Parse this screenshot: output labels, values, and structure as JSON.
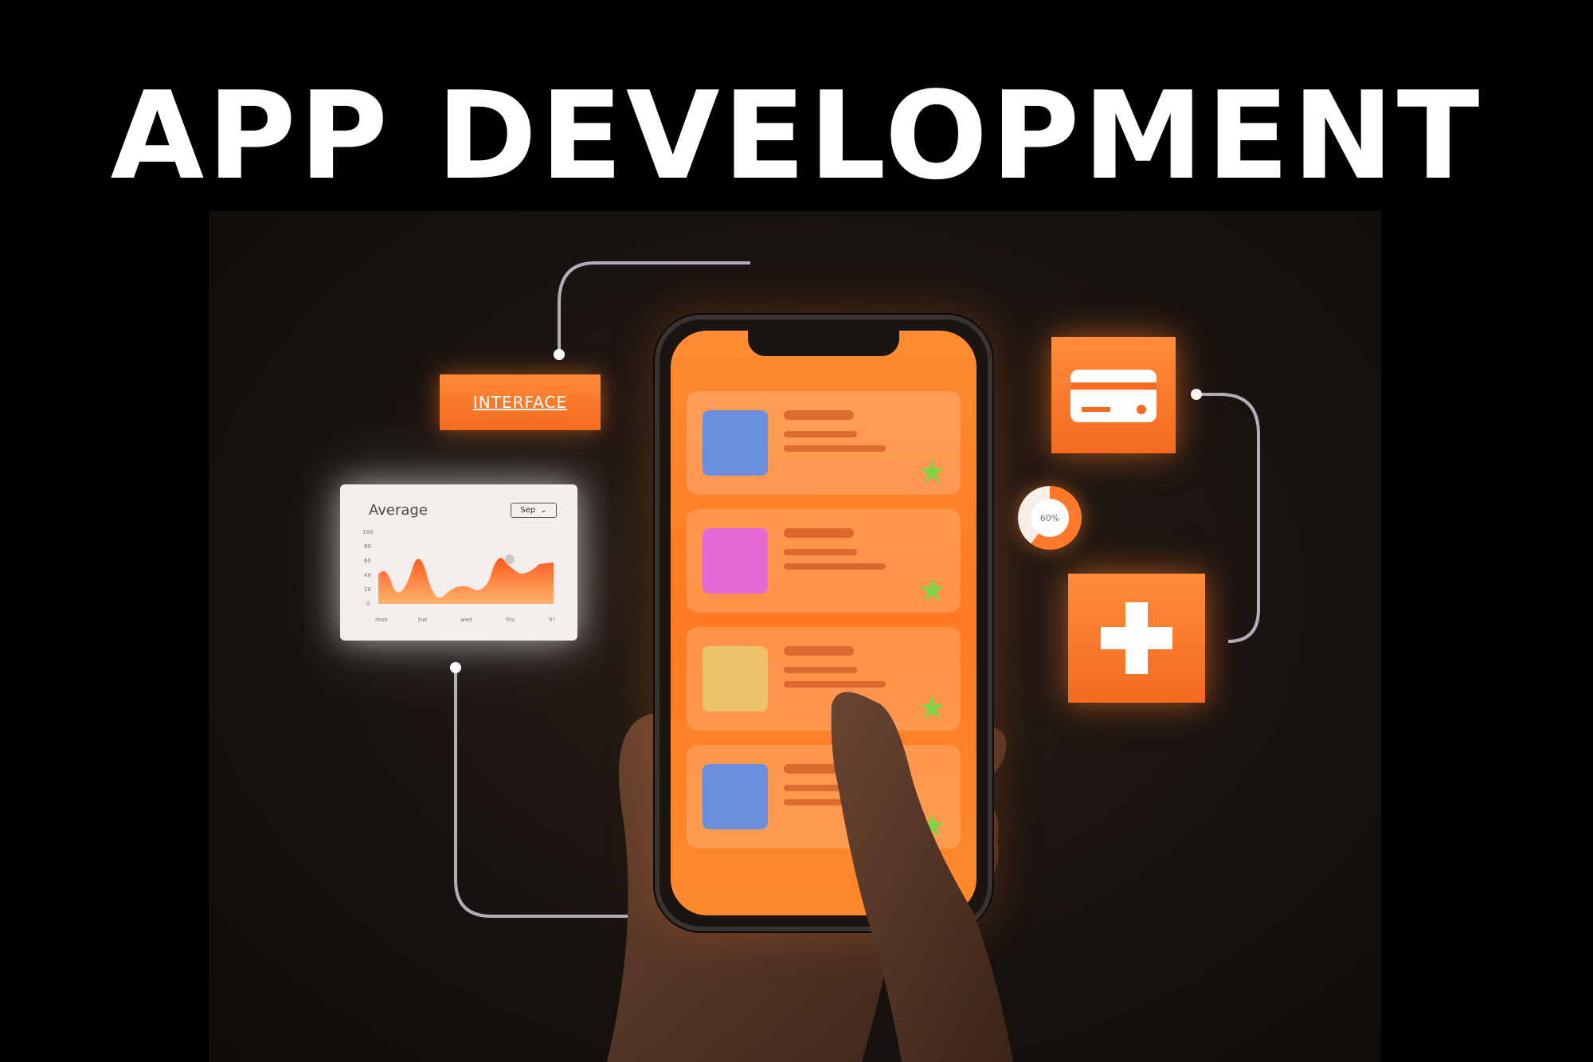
{
  "header": {
    "title": "APP DEVELOPMENT"
  },
  "illustration": {
    "interface_label": "INTERFACE",
    "chart_card": {
      "title": "Average",
      "selected_month": "Sep",
      "y_ticks": [
        "100",
        "80",
        "60",
        "40",
        "20",
        "0"
      ],
      "x_ticks": [
        "mon",
        "tue",
        "wed",
        "thu",
        "fri"
      ]
    },
    "progress_ring": {
      "label": "60%",
      "value": 0.6
    },
    "phone_items": [
      {
        "avatar_color": "#6d8fe0"
      },
      {
        "avatar_color": "#e46ad6"
      },
      {
        "avatar_color": "#e9c26a"
      },
      {
        "avatar_color": "#6d8fe0"
      }
    ],
    "colors": {
      "accent": "#ff7a22",
      "star": "#7fd24a",
      "connector": "#cfc9d6"
    },
    "icons": [
      "credit-card-icon",
      "plus-icon",
      "user-icon",
      "star-icon",
      "chevron-down-icon"
    ]
  }
}
